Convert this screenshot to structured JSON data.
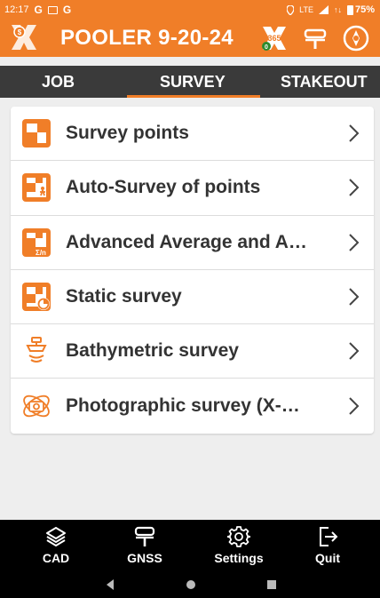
{
  "status_bar": {
    "time": "12:17",
    "left_icons": [
      "G",
      "G"
    ],
    "network": "LTE",
    "signal_text": "↑↓",
    "battery": "75%"
  },
  "app_bar": {
    "title": "POOLER 9-20-24",
    "badge_365": "365",
    "colors": {
      "accent": "#f07e28",
      "dark": "#3a3a3a"
    }
  },
  "tabs": [
    {
      "label": "JOB",
      "active": false
    },
    {
      "label": "SURVEY",
      "active": true
    },
    {
      "label": "STAKEOUT",
      "active": false
    }
  ],
  "menu": {
    "items": [
      {
        "label": "Survey points",
        "icon": "survey-points-icon"
      },
      {
        "label": "Auto-Survey of points",
        "icon": "auto-survey-icon"
      },
      {
        "label": "Advanced Average and A…",
        "icon": "advanced-average-icon"
      },
      {
        "label": "Static survey",
        "icon": "static-survey-icon"
      },
      {
        "label": "Bathymetric survey",
        "icon": "bathymetric-icon"
      },
      {
        "label": "Photographic survey (X-…",
        "icon": "photographic-icon"
      }
    ]
  },
  "bottom_nav": {
    "items": [
      {
        "label": "CAD",
        "icon": "layers-icon"
      },
      {
        "label": "GNSS",
        "icon": "gnss-receiver-icon"
      },
      {
        "label": "Settings",
        "icon": "gear-icon"
      },
      {
        "label": "Quit",
        "icon": "exit-icon"
      }
    ]
  }
}
